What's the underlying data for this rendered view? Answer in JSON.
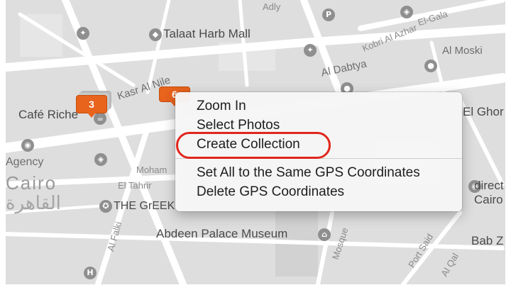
{
  "map": {
    "labels": {
      "adly": "Adly",
      "el_galaa": "El-Gala",
      "kobri_al_azhar": "Kobri Al Azhar",
      "al_moski": "Al Moski",
      "talaat_harb_mall": "Talaat Harb Mall",
      "al_dabtya": "Al Dabtya",
      "kasr_al_nile": "Kasr Al Nile",
      "cafe_riche": "Café Riche",
      "el_ghor": "El Ghor",
      "agency": "Agency",
      "cairo": "Cairo",
      "cairo_arabic": "القاهرة",
      "mohamed": "Moham",
      "el_tahrir": "El Tahrir",
      "the_greek": "THE GrEEK",
      "direct": "direct",
      "cairo_right": "Cairo",
      "al_falki": "Al Falki",
      "abdeen_palace_museum": "Abdeen Palace Museum",
      "mosque": "Mosque",
      "port_said": "Port Said",
      "al_qal": "Al Qal",
      "bab_z": "Bab Z"
    },
    "poi_glyphs": {
      "parking": "P",
      "hospital": "H"
    },
    "clusters": {
      "cluster_left": "3",
      "cluster_top": "6"
    },
    "colors": {
      "map_bg": "#dedede",
      "road": "#ffffff",
      "cluster": "#e8631c",
      "highlight": "#e0261c"
    }
  },
  "context_menu": {
    "items": [
      {
        "label": "Zoom In"
      },
      {
        "label": "Select Photos"
      },
      {
        "label": "Create Collection"
      }
    ],
    "items_after_separator": [
      {
        "label": "Set All to the Same GPS Coordinates"
      },
      {
        "label": "Delete GPS Coordinates"
      }
    ],
    "highlighted_item": "Create Collection"
  }
}
